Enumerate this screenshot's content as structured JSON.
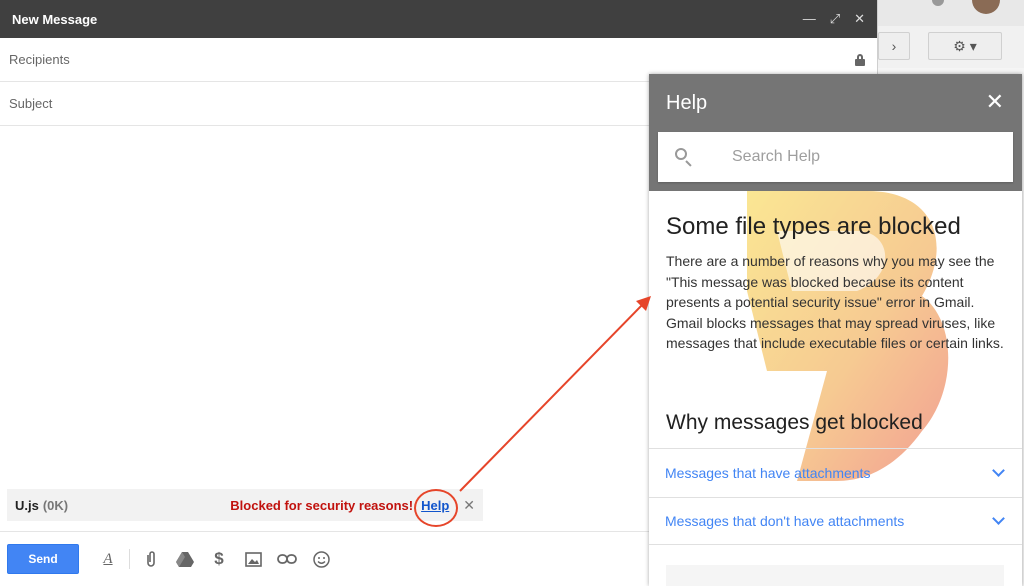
{
  "compose": {
    "title": "New Message",
    "recipients_placeholder": "Recipients",
    "subject_placeholder": "Subject",
    "attachment": {
      "name": "U.js",
      "size": "(0K)",
      "warning": "Blocked for security reasons!",
      "help_link": "Help"
    },
    "send_label": "Send"
  },
  "help": {
    "title": "Help",
    "search_placeholder": "Search Help",
    "article_title": "Some file types are blocked",
    "article_text": "There are a number of reasons why you may see the \"This message was blocked because its content presents a potential security issue\" error in Gmail. Gmail blocks messages that may spread viruses, like messages that include executable files or certain links.",
    "section_title": "Why messages get blocked",
    "links": [
      {
        "label": "Messages that have attachments"
      },
      {
        "label": "Messages that don't have attachments"
      }
    ]
  },
  "colors": {
    "header_dark": "#404040",
    "help_header": "#757575",
    "link_blue": "#4285f4",
    "warning_red": "#c1120e",
    "annotation_arrow": "#e6452a"
  }
}
